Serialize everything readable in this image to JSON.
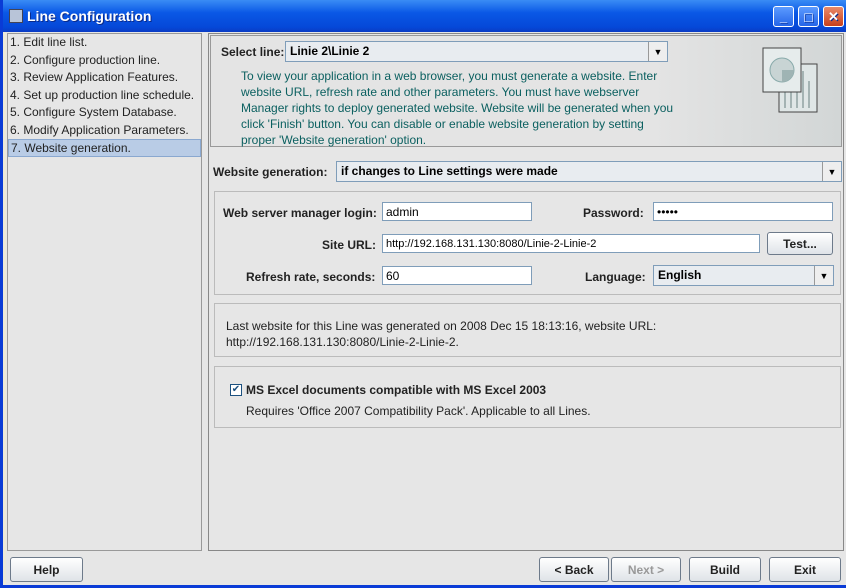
{
  "window": {
    "title": "Line Configuration",
    "minimize": "_",
    "maximize": "□",
    "close": "✕"
  },
  "steps": [
    {
      "label": "1. Edit line list."
    },
    {
      "label": "2. Configure production line."
    },
    {
      "label": "3. Review Application Features."
    },
    {
      "label": "4. Set up production line schedule."
    },
    {
      "label": "5. Configure System Database."
    },
    {
      "label": "6. Modify Application Parameters."
    },
    {
      "label": "7. Website generation.",
      "selected": true
    }
  ],
  "header": {
    "select_line_label": "Select line:",
    "select_line_value": "Linie 2\\Linie 2",
    "description": "To view your application in a web browser, you must generate a website. Enter website URL, refresh rate and other parameters. You must have webserver Manager rights to deploy generated website. Website will be generated when you click 'Finish' button. You can disable or enable website generation by setting proper 'Website generation' option."
  },
  "website_generation": {
    "label": "Website generation:",
    "value": "if changes to Line settings were made"
  },
  "form": {
    "login_label": "Web server manager login:",
    "login_value": "admin",
    "password_label": "Password:",
    "password_value": "•••••",
    "site_url_label": "Site URL:",
    "site_url_value": "http://192.168.131.130:8080/Linie-2-Linie-2",
    "test_button": "Test...",
    "refresh_label": "Refresh rate, seconds:",
    "refresh_value": "60",
    "language_label": "Language:",
    "language_value": "English"
  },
  "info": {
    "text": "Last website for this Line was generated on 2008 Dec 15 18:13:16, website URL: http://192.168.131.130:8080/Linie-2-Linie-2."
  },
  "excel": {
    "checked": true,
    "check_mark": "✔",
    "label": "MS Excel documents compatible with MS Excel 2003",
    "note": "Requires 'Office 2007 Compatibility Pack'. Applicable to all Lines."
  },
  "buttons": {
    "help": "Help",
    "back": "< Back",
    "next": "Next >",
    "build": "Build",
    "exit": "Exit"
  }
}
